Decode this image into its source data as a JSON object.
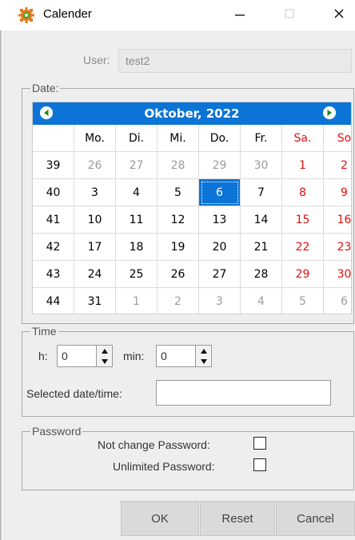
{
  "window": {
    "title": "Calender",
    "app_icon": "gear-app-icon",
    "controls": [
      "minimize-icon",
      "maximize-icon",
      "close-icon"
    ]
  },
  "user": {
    "label": "User:",
    "value": "test2"
  },
  "date_group": {
    "legend": "Date:",
    "month_label": "Oktober, 2022",
    "weekday_headers": [
      "Mo.",
      "Di.",
      "Mi.",
      "Do.",
      "Fr.",
      "Sa.",
      "So"
    ],
    "weeks": [
      {
        "week": "39",
        "days": [
          {
            "d": "26",
            "t": "out"
          },
          {
            "d": "27",
            "t": "out"
          },
          {
            "d": "28",
            "t": "out"
          },
          {
            "d": "29",
            "t": "out"
          },
          {
            "d": "30",
            "t": "out"
          },
          {
            "d": "1",
            "t": "weekend"
          },
          {
            "d": "2",
            "t": "weekend"
          }
        ]
      },
      {
        "week": "40",
        "days": [
          {
            "d": "3",
            "t": "in"
          },
          {
            "d": "4",
            "t": "in"
          },
          {
            "d": "5",
            "t": "in"
          },
          {
            "d": "6",
            "t": "selected"
          },
          {
            "d": "7",
            "t": "in"
          },
          {
            "d": "8",
            "t": "weekend"
          },
          {
            "d": "9",
            "t": "weekend"
          }
        ]
      },
      {
        "week": "41",
        "days": [
          {
            "d": "10",
            "t": "in"
          },
          {
            "d": "11",
            "t": "in"
          },
          {
            "d": "12",
            "t": "in"
          },
          {
            "d": "13",
            "t": "in"
          },
          {
            "d": "14",
            "t": "in"
          },
          {
            "d": "15",
            "t": "weekend"
          },
          {
            "d": "16",
            "t": "weekend"
          }
        ]
      },
      {
        "week": "42",
        "days": [
          {
            "d": "17",
            "t": "in"
          },
          {
            "d": "18",
            "t": "in"
          },
          {
            "d": "19",
            "t": "in"
          },
          {
            "d": "20",
            "t": "in"
          },
          {
            "d": "21",
            "t": "in"
          },
          {
            "d": "22",
            "t": "weekend"
          },
          {
            "d": "23",
            "t": "weekend"
          }
        ]
      },
      {
        "week": "43",
        "days": [
          {
            "d": "24",
            "t": "in"
          },
          {
            "d": "25",
            "t": "in"
          },
          {
            "d": "26",
            "t": "in"
          },
          {
            "d": "27",
            "t": "in"
          },
          {
            "d": "28",
            "t": "in"
          },
          {
            "d": "29",
            "t": "weekend"
          },
          {
            "d": "30",
            "t": "weekend"
          }
        ]
      },
      {
        "week": "44",
        "days": [
          {
            "d": "31",
            "t": "in"
          },
          {
            "d": "1",
            "t": "out"
          },
          {
            "d": "2",
            "t": "out"
          },
          {
            "d": "3",
            "t": "out"
          },
          {
            "d": "4",
            "t": "out"
          },
          {
            "d": "5",
            "t": "out"
          },
          {
            "d": "6",
            "t": "out"
          }
        ]
      }
    ]
  },
  "time_group": {
    "legend": "Time",
    "hour_label": "h:",
    "hour_value": "0",
    "minute_label": "min:",
    "minute_value": "0",
    "selected_label": "Selected date/time:",
    "selected_value": ""
  },
  "password_group": {
    "legend": "Password",
    "not_change_label": "Not change Password:",
    "not_change_checked": false,
    "unlimited_label": "Unlimited Password:",
    "unlimited_checked": false
  },
  "buttons": {
    "ok": "OK",
    "reset": "Reset",
    "cancel": "Cancel"
  },
  "colors": {
    "header_blue": "#0b74d6",
    "weekend_red": "#e01010",
    "out_of_month_gray": "#9b9b9b"
  }
}
